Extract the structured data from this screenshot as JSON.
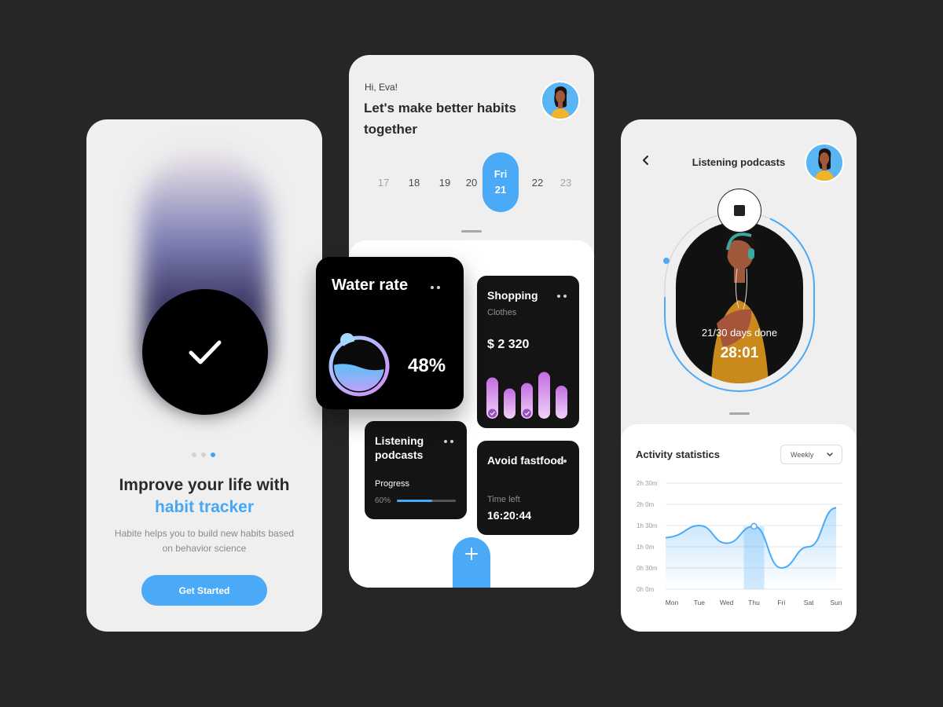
{
  "colors": {
    "background": "#262528",
    "accent": "#4aaaf7",
    "card": "#141414",
    "phone": "#efefef"
  },
  "onboarding": {
    "headline": "Improve your life with",
    "headline_accent": "habit tracker",
    "description": "Habite helps you to build new habits based on behavior science",
    "cta_label": "Get Started",
    "pager": {
      "count": 3,
      "active": 3
    },
    "icon": "check-icon"
  },
  "home": {
    "greeting": "Hi, Eva!",
    "headline": "Let's make better habits together",
    "dates": [
      {
        "label": "17",
        "state": "faded"
      },
      {
        "label": "18",
        "state": "normal"
      },
      {
        "label": "19",
        "state": "normal"
      },
      {
        "label": "20",
        "state": "normal"
      },
      {
        "day": "Fri",
        "label": "21",
        "state": "selected"
      },
      {
        "label": "22",
        "state": "normal"
      },
      {
        "label": "23",
        "state": "faded"
      }
    ],
    "water": {
      "title": "Water rate",
      "percent": "48%",
      "level": 0.48
    },
    "shopping": {
      "title": "Shopping",
      "subtitle": "Clothes",
      "amount": "$ 2 320",
      "bars": [
        0.75,
        0.55,
        0.65,
        0.85,
        0.6
      ],
      "checked_bars": [
        0,
        2
      ]
    },
    "podcasts": {
      "title": "Listening podcasts",
      "progress_label": "Progress",
      "progress_text": "60%",
      "progress": 0.6
    },
    "fastfood": {
      "title": "Avoid fastfood",
      "time_label": "Time left",
      "time_value": "16:20:44"
    },
    "add_icon": "plus-icon"
  },
  "detail": {
    "title": "Listening podcasts",
    "days_done": "21/30 days done",
    "timer": "28:01",
    "timer_progress": 0.7,
    "stats_title": "Activity statistics",
    "period": "Weekly",
    "chart_data": {
      "type": "area",
      "categories": [
        "Mon",
        "Tue",
        "Wed",
        "Thu",
        "Fri",
        "Sat",
        "Sun"
      ],
      "y_ticks": [
        "0h 0m",
        "0h 30m",
        "1h 0m",
        "1h 30m",
        "2h 0m",
        "2h 30m"
      ],
      "ylim": [
        0,
        150
      ],
      "values": [
        75,
        90,
        65,
        89,
        30,
        60,
        115
      ],
      "highlight": "Thu",
      "grid": true
    }
  }
}
